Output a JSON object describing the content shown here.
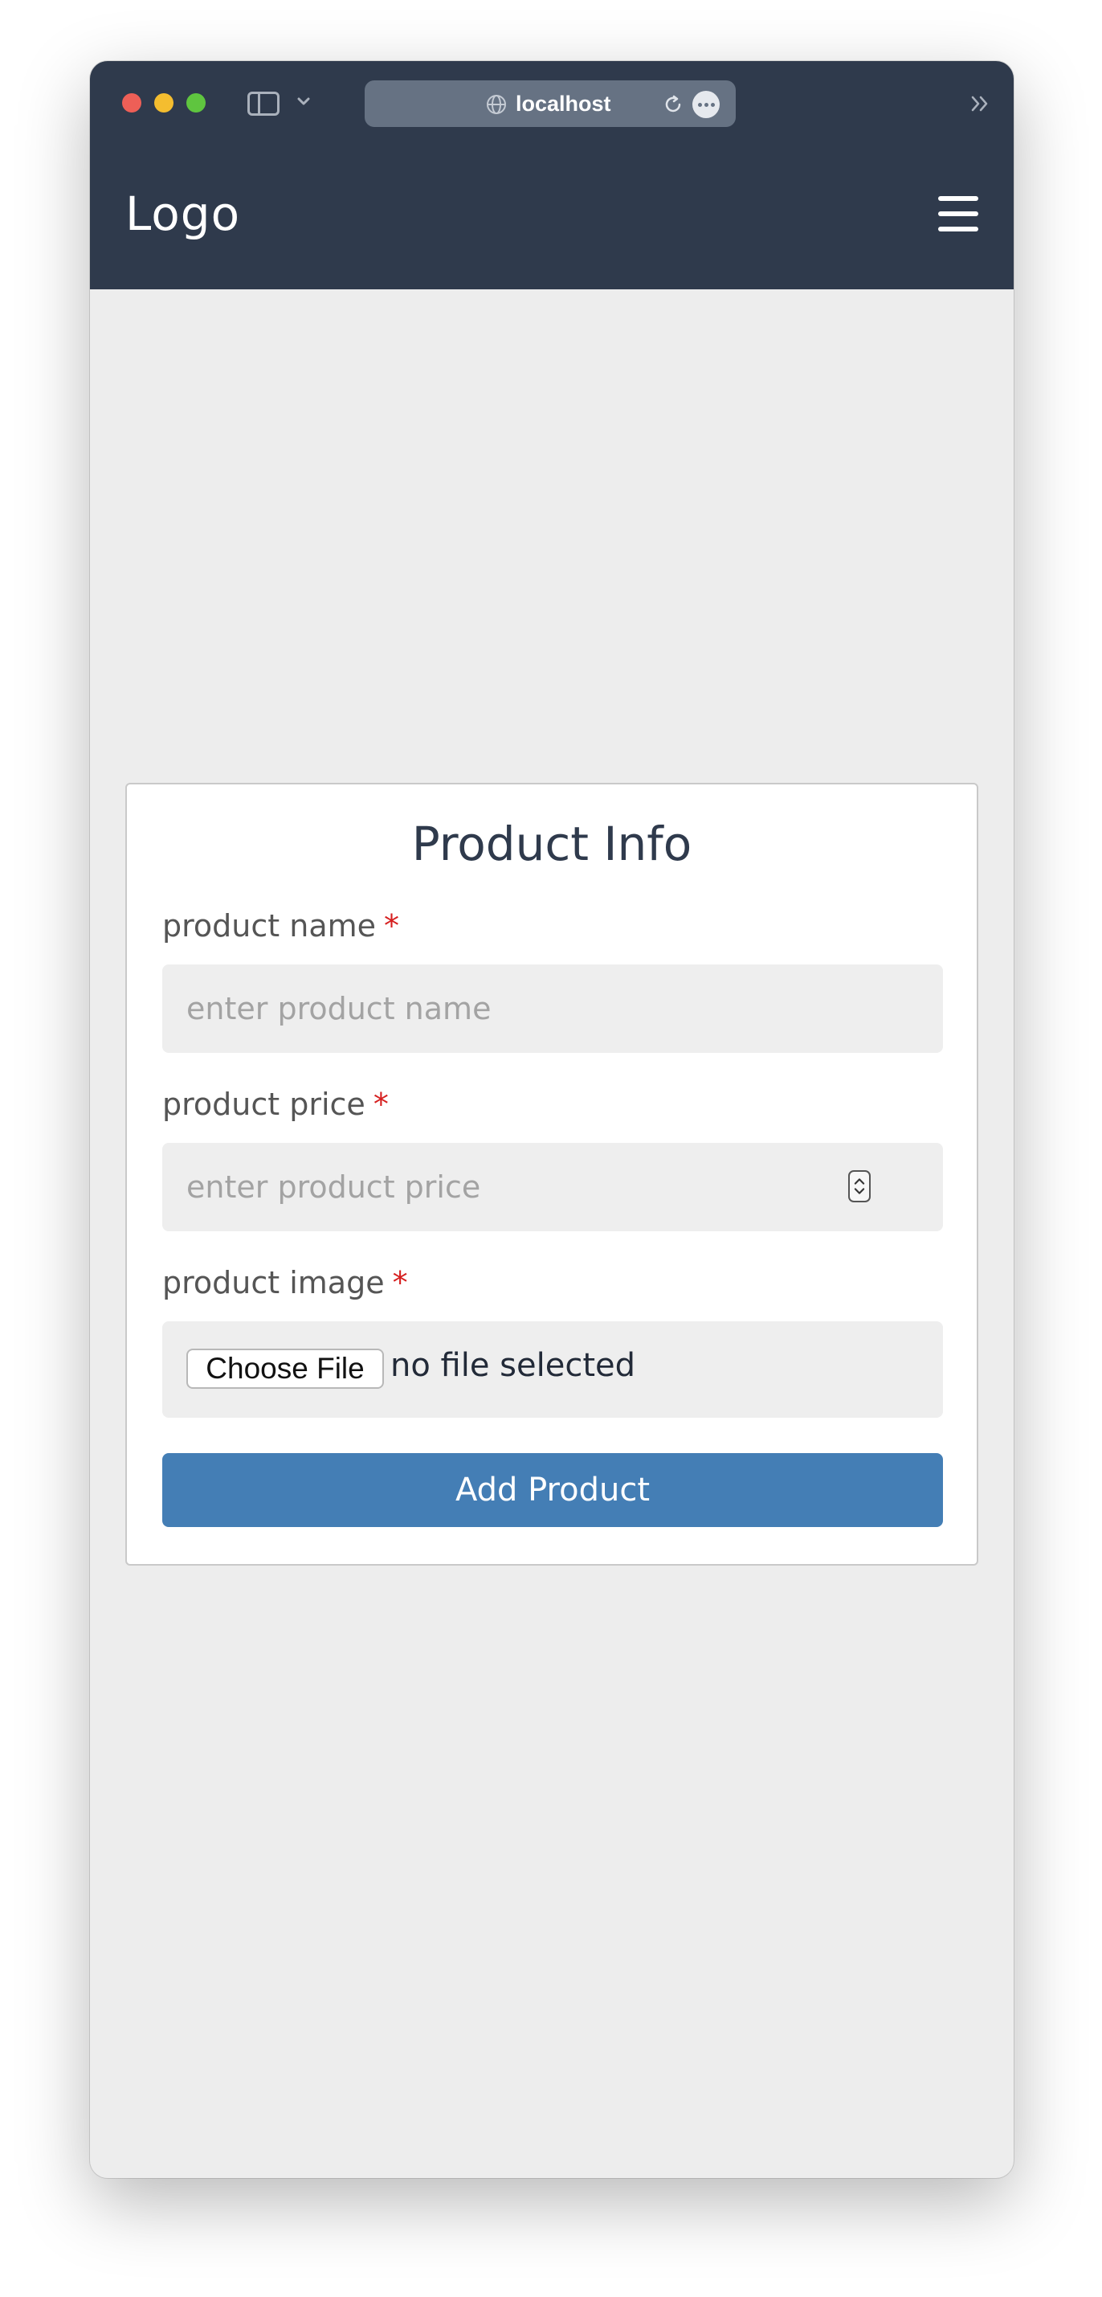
{
  "browser": {
    "url": "localhost"
  },
  "header": {
    "logo": "Logo"
  },
  "form": {
    "title": "Product Info",
    "required_marker": "*",
    "fields": [
      {
        "label": "product name",
        "placeholder": "enter product name"
      },
      {
        "label": "product price",
        "placeholder": "enter product price"
      },
      {
        "label": "product image",
        "button_label": "Choose File",
        "status": "no file selected"
      }
    ],
    "submit_label": "Add Product"
  },
  "colors": {
    "header_bg": "#2f3a4c",
    "page_bg": "#ededed",
    "accent": "#447eb5",
    "required": "#d61f1f"
  }
}
